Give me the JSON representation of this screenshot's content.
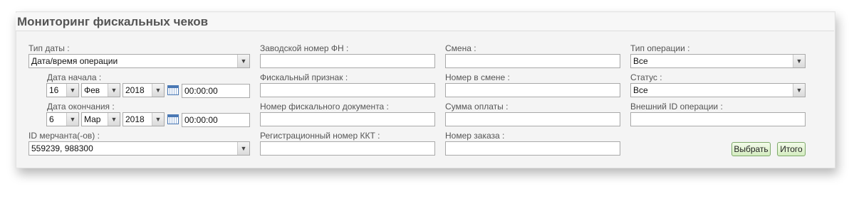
{
  "title": "Мониторинг фискальных чеков",
  "col1": {
    "date_type_label": "Тип даты :",
    "date_type_value": "Дата/время операции",
    "start_label": "Дата начала :",
    "start_day": "16",
    "start_month": "Фев",
    "start_year": "2018",
    "start_time": "00:00:00",
    "end_label": "Дата окончания :",
    "end_day": "6",
    "end_month": "Мар",
    "end_year": "2018",
    "end_time": "00:00:00",
    "merchant_label": "ID мерчанта(-ов) :",
    "merchant_value": "559239, 988300"
  },
  "col2": {
    "fn_label": "Заводской номер ФН :",
    "fn_value": "",
    "fiscal_sign_label": "Фискальный признак :",
    "fiscal_sign_value": "",
    "fiscal_doc_label": "Номер фискального документа :",
    "fiscal_doc_value": "",
    "kkt_label": "Регистрационный номер ККТ :",
    "kkt_value": ""
  },
  "col3": {
    "shift_label": "Смена :",
    "shift_value": "",
    "shift_num_label": "Номер в смене :",
    "shift_num_value": "",
    "amount_label": "Сумма оплаты :",
    "amount_value": "",
    "order_label": "Номер заказа :",
    "order_value": ""
  },
  "col4": {
    "op_type_label": "Тип операции :",
    "op_type_value": "Все",
    "status_label": "Статус :",
    "status_value": "Все",
    "ext_id_label": "Внешний ID операции :",
    "ext_id_value": ""
  },
  "buttons": {
    "select_label": "Выбрать",
    "total_label": "Итого"
  },
  "icons": {
    "dropdown": "chevron-down-icon",
    "calendar": "calendar-icon"
  }
}
